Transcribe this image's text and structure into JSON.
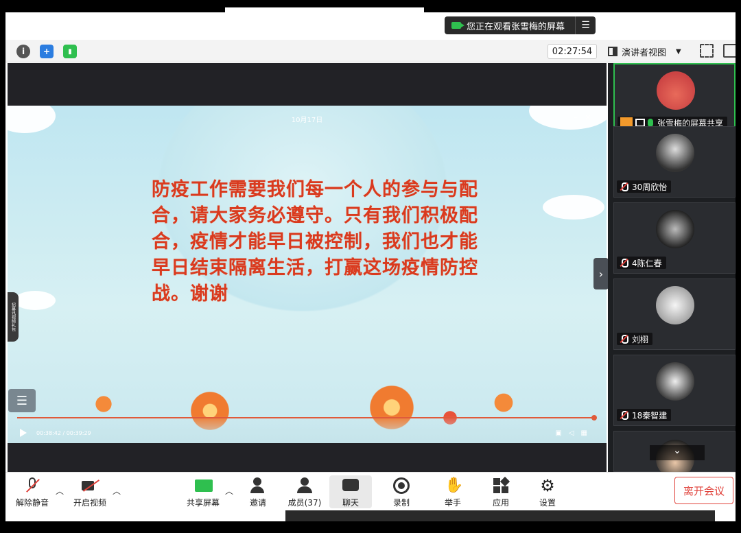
{
  "banner": {
    "text": "您正在观看张雪梅的屏幕"
  },
  "toolbar": {
    "timer": "02:27:54",
    "view_label": "演讲者视图"
  },
  "video": {
    "title": "10月17日",
    "slide_text": "防疫工作需要我们每一个人的参与与配合，请大家务必遵守。只有我们积极配合，疫情才能早日被控制，我们也才能早日结束隔离生活，打赢这场疫情防控战。谢谢",
    "time": "00:38:42 / 00:39:29",
    "progress": 0.98,
    "side_tab": "招募讯视频礼包"
  },
  "participants": [
    {
      "name": "张雪梅的屏幕共享"
    },
    {
      "name": "30周欣怡"
    },
    {
      "name": "4陈仁春"
    },
    {
      "name": "刘栩"
    },
    {
      "name": "18秦智建"
    }
  ],
  "bottom": {
    "unmute": "解除静音",
    "video": "开启视频",
    "share": "共享屏幕",
    "invite": "邀请",
    "members": "成员(37)",
    "chat": "聊天",
    "record": "录制",
    "raise_hand": "举手",
    "apps": "应用",
    "settings": "设置",
    "leave": "离开会议"
  },
  "colors": {
    "accent_green": "#2fbf4f",
    "leave_red": "#e0413a",
    "slide_red": "#d93a1f"
  }
}
